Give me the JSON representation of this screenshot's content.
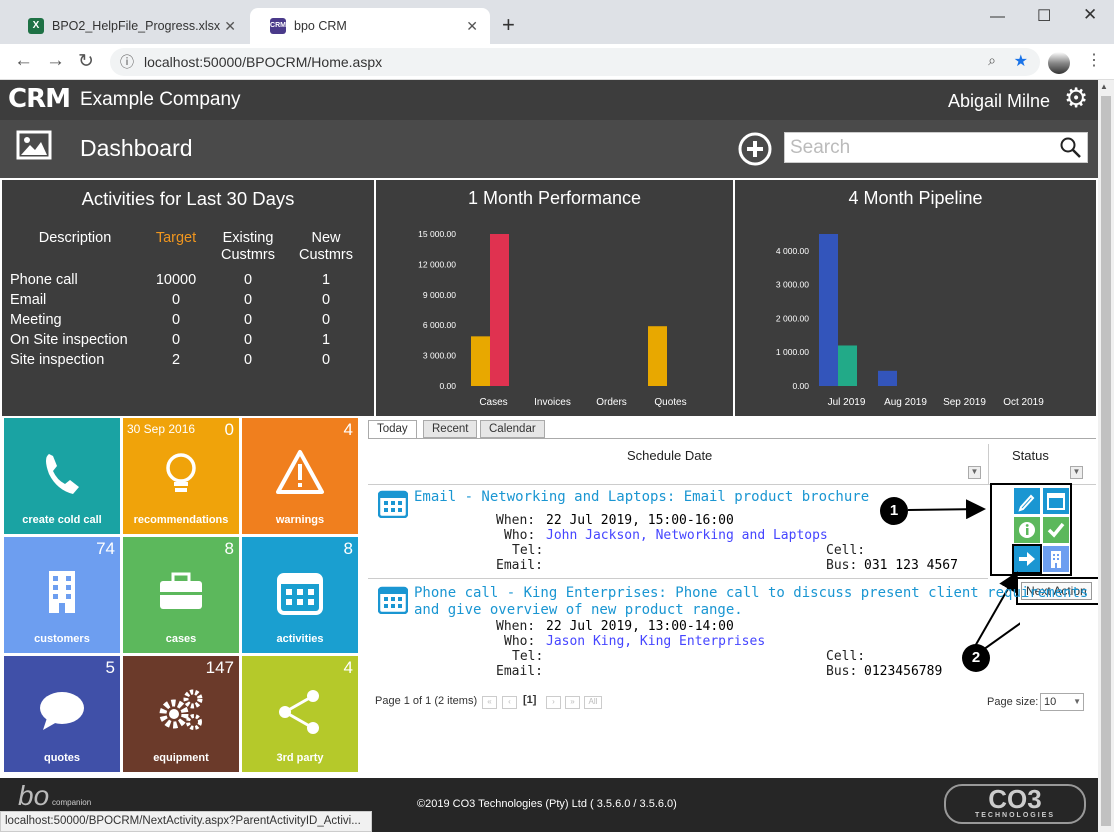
{
  "browser": {
    "tabs": [
      {
        "label": "BPO2_HelpFile_Progress.xlsx",
        "icon": "excel-icon"
      },
      {
        "label": "bpo CRM",
        "icon": "crm-icon"
      }
    ],
    "new_tab": "+",
    "url": "localhost:50000/BPOCRM/Home.aspx",
    "status_url": "localhost:50000/BPOCRM/NextActivity.aspx?ParentActivityID_Activi..."
  },
  "app": {
    "logo": "CRM",
    "company": "Example Company",
    "user": "Abigail Milne",
    "page_title": "Dashboard",
    "search_placeholder": "Search"
  },
  "activities": {
    "title": "Activities for Last 30 Days",
    "headers": [
      "Description",
      "Target",
      "Existing Custmrs",
      "New Custmrs"
    ],
    "rows": [
      {
        "desc": "Phone call",
        "target": "10000",
        "existing": "0",
        "new": "1"
      },
      {
        "desc": "Email",
        "target": "0",
        "existing": "0",
        "new": "0"
      },
      {
        "desc": "Meeting",
        "target": "0",
        "existing": "0",
        "new": "0"
      },
      {
        "desc": "On Site inspection",
        "target": "0",
        "existing": "0",
        "new": "1"
      },
      {
        "desc": "Site inspection",
        "target": "2",
        "existing": "0",
        "new": "0"
      }
    ]
  },
  "chart_data": [
    {
      "type": "bar",
      "title": "1 Month Performance",
      "categories": [
        "Cases",
        "Invoices",
        "Orders",
        "Quotes"
      ],
      "series": [
        {
          "values": [
            4900,
            0,
            0,
            5900
          ],
          "color": "#e8a800"
        },
        {
          "values": [
            15000,
            0,
            0,
            0
          ],
          "color": "#e03250"
        }
      ],
      "yticks": [
        "0.00",
        "3 000.00",
        "6 000.00",
        "9 000.00",
        "12 000.00",
        "15 000.00"
      ],
      "ylim": [
        0,
        15000
      ]
    },
    {
      "type": "bar",
      "title": "4 Month Pipeline",
      "categories": [
        "Jul 2019",
        "Aug 2019",
        "Sep 2019",
        "Oct 2019"
      ],
      "series": [
        {
          "values": [
            4500,
            450,
            0,
            0
          ],
          "color": "#3355bb"
        },
        {
          "values": [
            1200,
            0,
            0,
            0
          ],
          "color": "#22aa88"
        }
      ],
      "yticks": [
        "0.00",
        "1 000.00",
        "2 000.00",
        "3 000.00",
        "4 000.00"
      ],
      "ylim": [
        0,
        4500
      ]
    }
  ],
  "tiles": [
    {
      "label": "create cold call",
      "count": "",
      "date": "",
      "color": "#1aa3a3",
      "icon": "phone-icon"
    },
    {
      "label": "recommendations",
      "count": "0",
      "date": "30 Sep 2016",
      "color": "#f0a30a",
      "icon": "lightbulb-icon"
    },
    {
      "label": "warnings",
      "count": "4",
      "date": "",
      "color": "#f07f1e",
      "icon": "warning-icon"
    },
    {
      "label": "customers",
      "count": "74",
      "date": "",
      "color": "#6d9ef0",
      "icon": "building-icon"
    },
    {
      "label": "cases",
      "count": "8",
      "date": "",
      "color": "#5cb85c",
      "icon": "briefcase-icon"
    },
    {
      "label": "activities",
      "count": "8",
      "date": "",
      "color": "#1a9fd0",
      "icon": "calendar-icon"
    },
    {
      "label": "quotes",
      "count": "5",
      "date": "",
      "color": "#4050a8",
      "icon": "speech-bubble-icon"
    },
    {
      "label": "equipment",
      "count": "147",
      "date": "",
      "color": "#6b3a2a",
      "icon": "gears-icon"
    },
    {
      "label": "3rd party",
      "count": "4",
      "date": "",
      "color": "#b5c92a",
      "icon": "share-icon"
    }
  ],
  "schedule": {
    "tabs": [
      "Today",
      "Recent",
      "Calendar"
    ],
    "col_date": "Schedule Date",
    "col_status": "Status",
    "labels": {
      "when": "When:",
      "who": "Who:",
      "tel": "Tel:",
      "email": "Email:",
      "cell": "Cell:",
      "bus": "Bus:"
    },
    "items": [
      {
        "title": "Email - Networking and Laptops: Email product brochure",
        "title2": "",
        "when": "22 Jul 2019, 15:00-16:00",
        "who": "John Jackson, Networking and Laptops",
        "bus": "031 123 4567"
      },
      {
        "title": "Phone call - King Enterprises: Phone call to discuss present client requirements",
        "title2": "and give overview of new product range.",
        "when": "22 Jul 2019, 13:00-14:00",
        "who": "Jason King, King Enterprises",
        "bus": "0123456789"
      }
    ],
    "pager": {
      "text": "Page 1 of 1 (2 items)",
      "current": "[1]",
      "all": "All",
      "size_label": "Page size:",
      "size": "10"
    },
    "tooltip": "Next Action",
    "callouts": [
      "1",
      "2"
    ]
  },
  "footer": {
    "copyright": "©2019 CO3 Technologies (Pty) Ltd ( 3.5.6.0 / 3.5.6.0)",
    "logo_left": "bo",
    "logo_sub": "companion",
    "logo_right": "CO3",
    "logo_right_sub": "TECHNOLOGIES"
  }
}
